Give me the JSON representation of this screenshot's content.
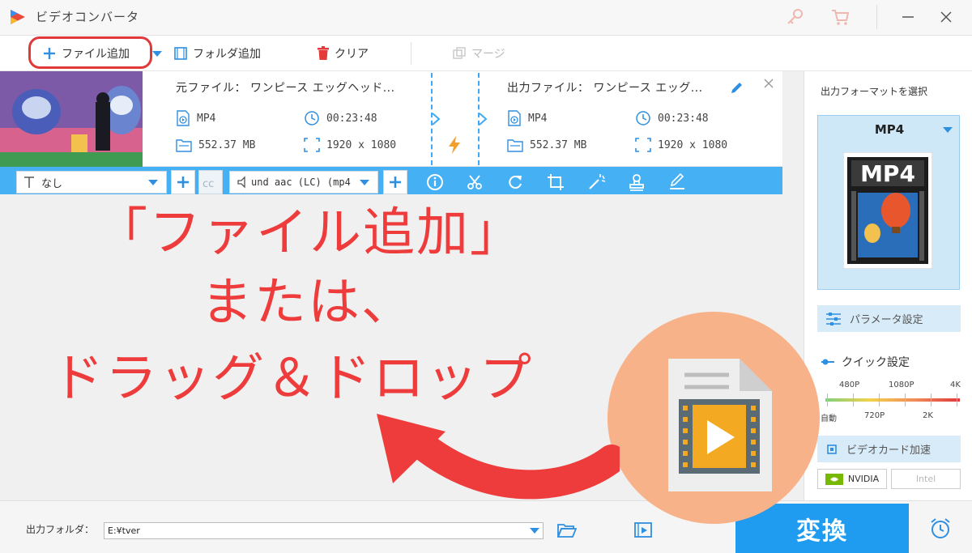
{
  "app": {
    "title": "ビデオコンバータ"
  },
  "toolbar": {
    "add_file": "ファイル追加",
    "add_folder": "フォルダ追加",
    "clear": "クリア",
    "merge": "マージ"
  },
  "file": {
    "source_label": "元ファイル：",
    "source_name": "ワンピース エッグヘッド...",
    "output_label": "出力ファイル：",
    "output_name": "ワンピース エッグ...",
    "source_format": "MP4",
    "source_duration": "00:23:48",
    "source_size": "552.37 MB",
    "source_resolution": "1920 x 1080",
    "output_format": "MP4",
    "output_duration": "00:23:48",
    "output_size": "552.37 MB",
    "output_resolution": "1920 x 1080"
  },
  "editbar": {
    "subtitle_value": "なし",
    "audio_value": "und aac (LC) (mp4"
  },
  "panel": {
    "title": "出力フォーマットを選択",
    "format": "MP4",
    "format_badge": "MP4",
    "param_button": "パラメータ設定",
    "quick_label": "クイック設定",
    "res_top": [
      "480P",
      "1080P",
      "4K"
    ],
    "res_bottom": [
      "自動",
      "720P",
      "2K"
    ],
    "gpu_button": "ビデオカード加速",
    "vendor_nvidia": "NVIDIA",
    "vendor_intel": "Intel"
  },
  "bottom": {
    "output_folder_label": "出力フォルダ：",
    "output_folder_value": "E:¥tver",
    "convert_label": "変換"
  },
  "overlay": {
    "line1": "「ファイル追加」",
    "line2": "または、",
    "line3": "ドラッグ＆ドロップ"
  },
  "colors": {
    "accent": "#1f9bf0",
    "annotation": "#ee3b3b",
    "circle": "#f7b289"
  }
}
